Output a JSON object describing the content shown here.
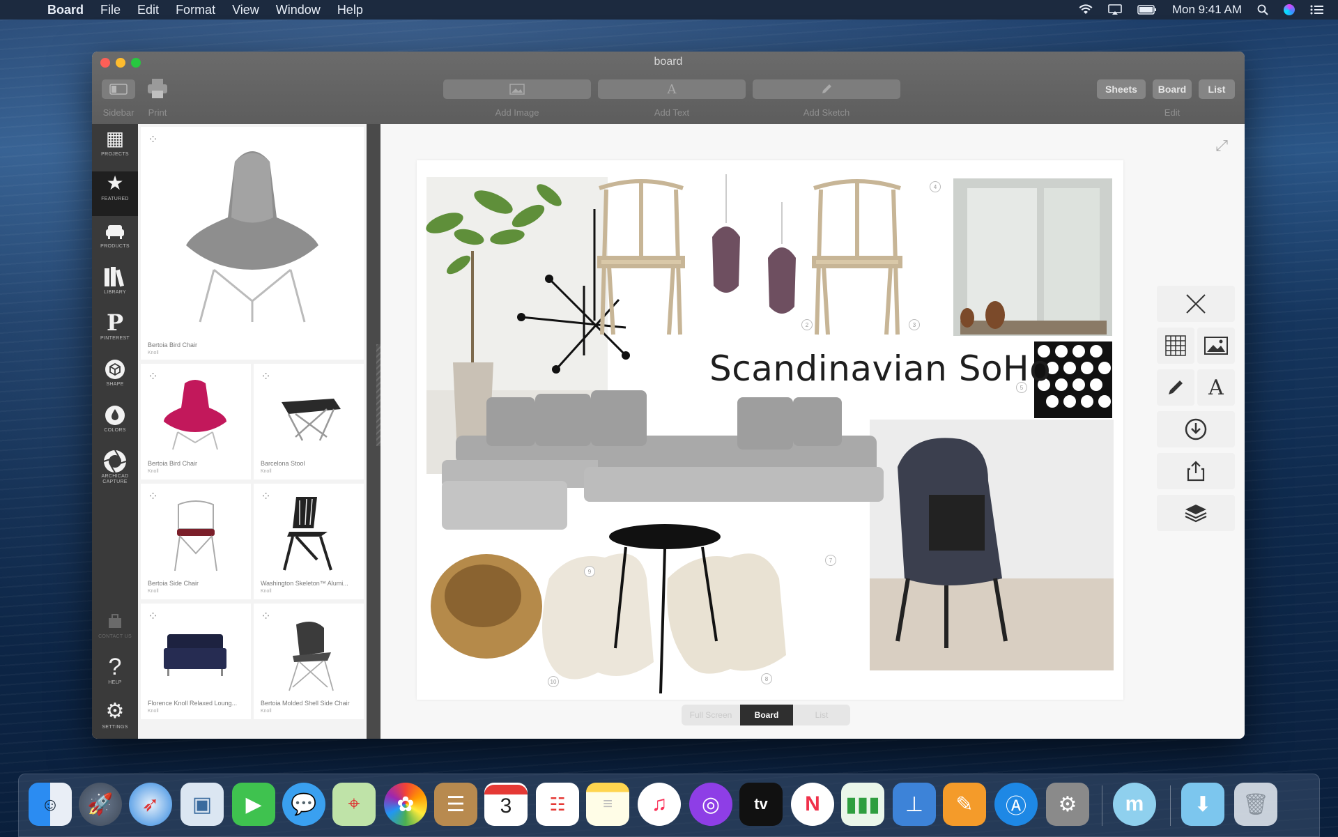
{
  "menubar": {
    "app_name": "Board",
    "menus": [
      "File",
      "Edit",
      "Format",
      "View",
      "Window",
      "Help"
    ],
    "clock": "Mon 9:41 AM"
  },
  "window": {
    "title": "board",
    "toolbar": {
      "sidebar_label": "Sidebar",
      "print_label": "Print",
      "add_image_label": "Add Image",
      "add_text_label": "Add Text",
      "add_sketch_label": "Add Sketch",
      "view_modes": [
        "Sheets",
        "Board",
        "List"
      ],
      "edit_label": "Edit"
    }
  },
  "rail": {
    "items": [
      {
        "label": "PROJECTS",
        "icon": "grid-icon"
      },
      {
        "label": "FEATURED",
        "icon": "star-icon"
      },
      {
        "label": "PRODUCTS",
        "icon": "sofa-icon"
      },
      {
        "label": "LIBRARY",
        "icon": "books-icon"
      },
      {
        "label": "PINTEREST",
        "icon": "pinterest-icon"
      },
      {
        "label": "SHAPE",
        "icon": "cube-icon"
      },
      {
        "label": "COLORS",
        "icon": "drop-icon"
      },
      {
        "label": "ARCHICAD CAPTURE",
        "icon": "aperture-icon"
      }
    ],
    "bottom": [
      {
        "label": "CONTACT US",
        "icon": "envelope-icon"
      },
      {
        "label": "HELP",
        "icon": "question-icon"
      },
      {
        "label": "SETTINGS",
        "icon": "gear-icon"
      }
    ]
  },
  "library": {
    "featured": {
      "name": "Bertoia Bird Chair",
      "brand": "Knoll"
    },
    "items": [
      {
        "name": "Bertoia Bird Chair",
        "brand": "Knoll"
      },
      {
        "name": "Barcelona Stool",
        "brand": "Knoll"
      },
      {
        "name": "Bertoia Side Chair",
        "brand": "Knoll"
      },
      {
        "name": "Washington Skeleton™ Alumi...",
        "brand": "Knoll"
      },
      {
        "name": "Florence Knoll Relaxed Loung...",
        "brand": "Knoll"
      },
      {
        "name": "Bertoia Molded Shell Side Chair",
        "brand": "Knoll"
      }
    ]
  },
  "board": {
    "title": "Scandinavian SoHo",
    "numbers": [
      "2",
      "3",
      "4",
      "5",
      "7",
      "8",
      "9",
      "10"
    ]
  },
  "tools": {
    "items": [
      "close-icon",
      "grid-icon",
      "image-icon",
      "pencil-icon",
      "text-icon",
      "download-icon",
      "share-icon",
      "layers-icon"
    ]
  },
  "bottom_switch": [
    "Full Screen",
    "Board",
    "List"
  ],
  "dock": {
    "apps": [
      "Finder",
      "Launchpad",
      "Safari",
      "Preview",
      "FaceTime",
      "Messages",
      "Maps",
      "Photos",
      "Contacts",
      "Calendar",
      "Reminders",
      "Notes",
      "Music",
      "Podcasts",
      "TV",
      "News",
      "Numbers",
      "Keynote",
      "Pages",
      "App Store",
      "System Preferences",
      "Moodboard",
      "Downloads",
      "Trash"
    ],
    "calendar_day": "3",
    "tv_label": "tv"
  },
  "colors": {
    "accent_active_seg": "#2f2f2f",
    "window_chrome": "#5f5f5f",
    "rail": "#3a3a3a"
  }
}
